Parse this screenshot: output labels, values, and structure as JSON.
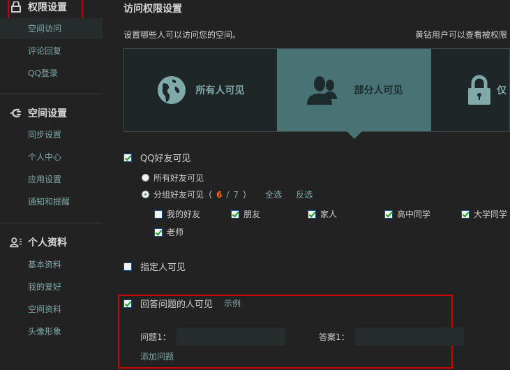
{
  "sidebar": {
    "sections": [
      {
        "title": "权限设置",
        "icon": "lock-icon",
        "items": [
          "空间访问",
          "评论回复",
          "QQ登录"
        ]
      },
      {
        "title": "空间设置",
        "icon": "plug-icon",
        "items": [
          "同步设置",
          "个人中心",
          "应用设置",
          "通知和提醒"
        ]
      },
      {
        "title": "个人资料",
        "icon": "profile-icon",
        "items": [
          "基本资料",
          "我的爱好",
          "空间资料",
          "头像形象"
        ]
      }
    ],
    "active": "空间访问"
  },
  "main": {
    "title": "访问权限设置",
    "description": "设置哪些人可以访问您的空间。",
    "note": "黄钻用户可以查看被权限",
    "cards": [
      {
        "label": "所有人可见",
        "icon": "globe-icon"
      },
      {
        "label": "部分人可见",
        "icon": "users-icon"
      },
      {
        "label": "仅",
        "icon": "lock-icon"
      }
    ],
    "qq_friends": {
      "label": "QQ好友可见",
      "checked": true,
      "all_friends": "所有好友可见",
      "group_friends": "分组好友可见（",
      "selected": "6",
      "total": "7",
      "close": "）",
      "sep": "/",
      "select_all": "全选",
      "invert": "反选",
      "groups": [
        {
          "name": "我的好友",
          "checked": false
        },
        {
          "name": "朋友",
          "checked": true
        },
        {
          "name": "家人",
          "checked": true
        },
        {
          "name": "高中同学",
          "checked": true
        },
        {
          "name": "大学同学",
          "checked": true
        },
        {
          "name": "老师",
          "checked": true
        }
      ]
    },
    "specific": {
      "label": "指定人可见",
      "checked": false
    },
    "question": {
      "label": "回答问题的人可见",
      "checked": true,
      "example": "示例",
      "q_label": "问题1：",
      "a_label": "答案1：",
      "q_value": "",
      "a_value": "",
      "add": "添加问题"
    }
  },
  "colors": {
    "accent": "#497275",
    "link": "#7fa8a8",
    "highlight": "#ff6600",
    "red": "#cc0000"
  }
}
